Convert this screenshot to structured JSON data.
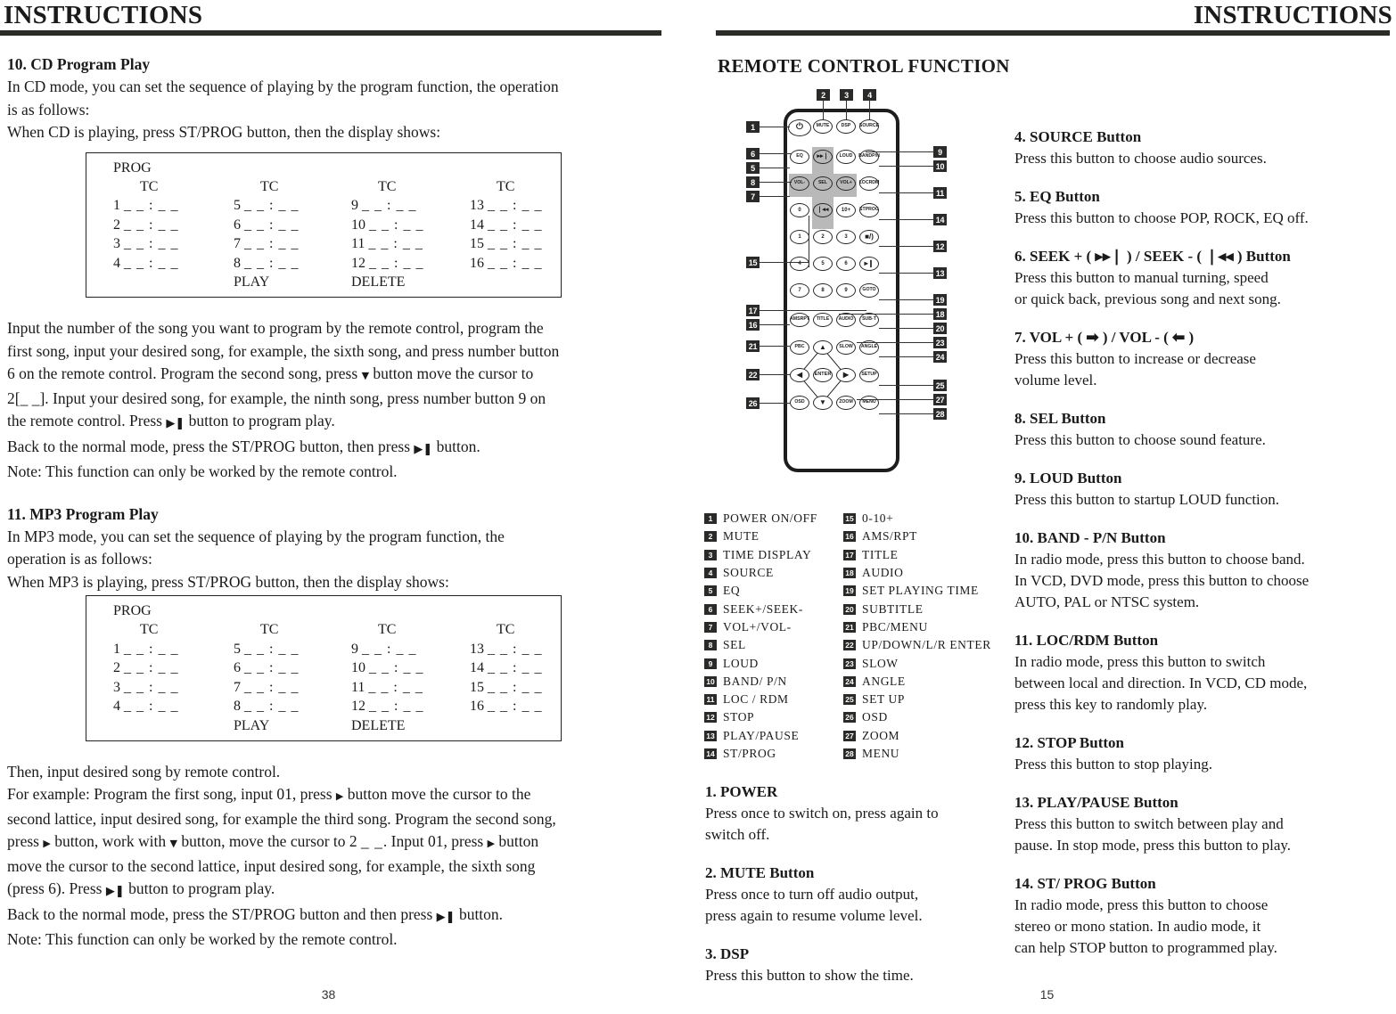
{
  "left_page": {
    "header_title": "INSTRUCTIONS",
    "page_number": "38",
    "section10": {
      "title": "10. CD Program Play",
      "line1": "In CD mode, you can set the sequence of playing by the program function, the operation",
      "line2": "is as follows:",
      "line3": "When CD is playing, press ST/PROG button, then the display shows:"
    },
    "prog_table": {
      "prog_label": "PROG",
      "tc_label": "TC",
      "blank_value": "_ _ : _ _",
      "rows_col1": [
        "1",
        "2",
        "3",
        "4"
      ],
      "rows_col2": [
        "5",
        "6",
        "7",
        "8"
      ],
      "rows_col3": [
        "9",
        "10",
        "11",
        "12"
      ],
      "rows_col4": [
        "13",
        "14",
        "15",
        "16"
      ],
      "play_label": "PLAY",
      "delete_label": "DELETE"
    },
    "para_cd": {
      "l1": "Input the number of the song you want to program by the remote control, program the",
      "l2": "first song, input your desired song, for example, the sixth song, and press number button",
      "l3a": "6 on the remote control. Program the second song, press",
      "l3icon": "▼",
      "l3b": "button move the cursor to",
      "l4a": "2",
      "l4brkt": "[_ _]",
      "l4b": ". Input your desired song, for example, the ninth song, press number button 9 on",
      "l5a": "the remote control. Press",
      "l5icon": "▶❚",
      "l5b": "button to program play.",
      "l6a": "Back to the normal mode, press the ST/PROG button, then press",
      "l6icon": "▶❚",
      "l6b": "button.",
      "l7": "Note: This function can only be worked by the remote control."
    },
    "section11": {
      "title": "11. MP3 Program Play",
      "line1": "In MP3 mode, you can set the sequence of playing by the program function, the",
      "line2": "operation is as follows:",
      "line3": "When MP3 is playing, press ST/PROG button, then the display shows:"
    },
    "para_mp3": {
      "l1": "Then, input desired song by remote control.",
      "l2a": "For example: Program the first song, input 01, press",
      "l2icon": "▶",
      "l2b": "button move the cursor to the",
      "l3": "second lattice, input desired song, for example the third song. Program the second song,",
      "l4a": "press",
      "l4icon1": "▶",
      "l4b": "button, work with",
      "l4icon2": "▼",
      "l4c": "button, move the cursor to 2",
      "l4blank": "_ _",
      "l4d": ". Input 01, press",
      "l4icon3": "▶",
      "l4e": "button",
      "l5": "move the cursor to the second lattice, input desired song, for example, the sixth song",
      "l6a": "(press 6). Press",
      "l6icon": "▶❚",
      "l6b": "button to program play.",
      "l7a": "Back to the normal mode, press the ST/PROG button and then press",
      "l7icon": "▶❚",
      "l7b": "button.",
      "l8": "Note: This function can only be worked by the remote control."
    }
  },
  "right_page": {
    "header_title": "INSTRUCTIONS",
    "page_number": "15",
    "section_heading": "REMOTE CONTROL FUNCTION",
    "remote": {
      "buttons": [
        {
          "label": "⏻",
          "row": 0,
          "col": 0,
          "shaded": false,
          "name": "power"
        },
        {
          "label": "MUTE",
          "row": 0,
          "col": 1,
          "shaded": false,
          "name": "mute"
        },
        {
          "label": "DSP",
          "row": 0,
          "col": 2,
          "shaded": false,
          "name": "dsp"
        },
        {
          "label": "SOURCE",
          "row": 0,
          "col": 3,
          "shaded": false,
          "name": "source"
        },
        {
          "label": "EQ",
          "row": 1,
          "col": 0,
          "shaded": false,
          "name": "eq"
        },
        {
          "label": "▸▸❘",
          "row": 1,
          "col": 1,
          "shaded": true,
          "name": "seek-plus"
        },
        {
          "label": "LOUD",
          "row": 1,
          "col": 2,
          "shaded": false,
          "name": "loud"
        },
        {
          "label": "BAND\nP/N",
          "row": 1,
          "col": 3,
          "shaded": false,
          "name": "band-pn"
        },
        {
          "label": "VOL-",
          "row": 2,
          "col": 0,
          "shaded": true,
          "name": "vol-minus"
        },
        {
          "label": "SEL",
          "row": 2,
          "col": 1,
          "shaded": true,
          "name": "sel"
        },
        {
          "label": "VOL+",
          "row": 2,
          "col": 2,
          "shaded": true,
          "name": "vol-plus"
        },
        {
          "label": "LOC\nRDM",
          "row": 2,
          "col": 3,
          "shaded": false,
          "name": "loc-rdm"
        },
        {
          "label": "0",
          "row": 3,
          "col": 0,
          "shaded": false,
          "name": "num-0"
        },
        {
          "label": "❘◂◂",
          "row": 3,
          "col": 1,
          "shaded": true,
          "name": "seek-minus"
        },
        {
          "label": "10+",
          "row": 3,
          "col": 2,
          "shaded": false,
          "name": "num-10plus"
        },
        {
          "label": "ST\nPROG",
          "row": 3,
          "col": 3,
          "shaded": false,
          "name": "st-prog"
        },
        {
          "label": "1",
          "row": 4,
          "col": 0,
          "shaded": false,
          "name": "num-1"
        },
        {
          "label": "2",
          "row": 4,
          "col": 1,
          "shaded": false,
          "name": "num-2"
        },
        {
          "label": "3",
          "row": 4,
          "col": 2,
          "shaded": false,
          "name": "num-3"
        },
        {
          "label": "■/)",
          "row": 4,
          "col": 3,
          "shaded": false,
          "name": "stop"
        },
        {
          "label": "4",
          "row": 5,
          "col": 0,
          "shaded": false,
          "name": "num-4"
        },
        {
          "label": "5",
          "row": 5,
          "col": 1,
          "shaded": false,
          "name": "num-5"
        },
        {
          "label": "6",
          "row": 5,
          "col": 2,
          "shaded": false,
          "name": "num-6"
        },
        {
          "label": "▸❙",
          "row": 5,
          "col": 3,
          "shaded": false,
          "name": "play-pause"
        },
        {
          "label": "7",
          "row": 6,
          "col": 0,
          "shaded": false,
          "name": "num-7"
        },
        {
          "label": "8",
          "row": 6,
          "col": 1,
          "shaded": false,
          "name": "num-8"
        },
        {
          "label": "9",
          "row": 6,
          "col": 2,
          "shaded": false,
          "name": "num-9"
        },
        {
          "label": "GOTO",
          "row": 6,
          "col": 3,
          "shaded": false,
          "name": "goto"
        },
        {
          "label": "AMS\nRPT",
          "row": 7,
          "col": 0,
          "shaded": false,
          "name": "ams-rpt"
        },
        {
          "label": "TITLE",
          "row": 7,
          "col": 1,
          "shaded": false,
          "name": "title"
        },
        {
          "label": "AUDIO",
          "row": 7,
          "col": 2,
          "shaded": false,
          "name": "audio"
        },
        {
          "label": "SUB-T",
          "row": 7,
          "col": 3,
          "shaded": false,
          "name": "sub-t"
        },
        {
          "label": "PBC",
          "row": 8,
          "col": 0,
          "shaded": false,
          "name": "pbc"
        },
        {
          "label": "▲",
          "row": 8,
          "col": 1,
          "shaded": false,
          "name": "up"
        },
        {
          "label": "SLOW",
          "row": 8,
          "col": 2,
          "shaded": false,
          "name": "slow"
        },
        {
          "label": "ANGLE",
          "row": 8,
          "col": 3,
          "shaded": false,
          "name": "angle"
        },
        {
          "label": "◀",
          "row": 9,
          "col": 0,
          "shaded": false,
          "name": "left"
        },
        {
          "label": "ENTER",
          "row": 9,
          "col": 1,
          "shaded": false,
          "name": "enter"
        },
        {
          "label": "▶",
          "row": 9,
          "col": 2,
          "shaded": false,
          "name": "right"
        },
        {
          "label": "SETUP",
          "row": 9,
          "col": 3,
          "shaded": false,
          "name": "setup"
        },
        {
          "label": "OSD",
          "row": 10,
          "col": 0,
          "shaded": false,
          "name": "osd"
        },
        {
          "label": "▼",
          "row": 10,
          "col": 1,
          "shaded": false,
          "name": "down"
        },
        {
          "label": "ZOOM",
          "row": 10,
          "col": 2,
          "shaded": false,
          "name": "zoom"
        },
        {
          "label": "MENU",
          "row": 10,
          "col": 3,
          "shaded": false,
          "name": "menu"
        }
      ],
      "top_callouts": [
        "2",
        "3",
        "4"
      ],
      "left_callouts": [
        "1",
        "6",
        "5",
        "8",
        "7",
        "15",
        "17",
        "16",
        "21",
        "22",
        "26"
      ],
      "right_callouts": [
        "9",
        "10",
        "11",
        "14",
        "12",
        "13",
        "19",
        "18",
        "20",
        "23",
        "24",
        "25",
        "27",
        "28"
      ]
    },
    "legend_col1": [
      {
        "n": "1",
        "t": "POWER ON/OFF"
      },
      {
        "n": "2",
        "t": "MUTE"
      },
      {
        "n": "3",
        "t": "TIME DISPLAY"
      },
      {
        "n": "4",
        "t": "SOURCE"
      },
      {
        "n": "5",
        "t": "EQ"
      },
      {
        "n": "6",
        "t": "SEEK+/SEEK-"
      },
      {
        "n": "7",
        "t": "VOL+/VOL-"
      },
      {
        "n": "8",
        "t": "SEL"
      },
      {
        "n": "9",
        "t": "LOUD"
      },
      {
        "n": "10",
        "t": "BAND/ P/N"
      },
      {
        "n": "11",
        "t": "LOC / RDM"
      },
      {
        "n": "12",
        "t": "STOP"
      },
      {
        "n": "13",
        "t": "PLAY/PAUSE"
      },
      {
        "n": "14",
        "t": "ST/PROG"
      }
    ],
    "legend_col2": [
      {
        "n": "15",
        "t": "0-10+"
      },
      {
        "n": "16",
        "t": "AMS/RPT"
      },
      {
        "n": "17",
        "t": "TITLE"
      },
      {
        "n": "18",
        "t": "AUDIO"
      },
      {
        "n": "19",
        "t": "SET PLAYING TIME"
      },
      {
        "n": "20",
        "t": "SUBTITLE"
      },
      {
        "n": "21",
        "t": "PBC/MENU"
      },
      {
        "n": "22",
        "t": " UP/DOWN/L/R ENTER"
      },
      {
        "n": "23",
        "t": "SLOW"
      },
      {
        "n": "24",
        "t": "ANGLE"
      },
      {
        "n": "25",
        "t": "SET UP"
      },
      {
        "n": "26",
        "t": "OSD"
      },
      {
        "n": "27",
        "t": "ZOOM"
      },
      {
        "n": "28",
        "t": "MENU"
      }
    ],
    "entries_lower_left": [
      {
        "title": "1. POWER",
        "lines": [
          "Press once to switch on, press again to",
          "switch off."
        ]
      },
      {
        "title": "2. MUTE Button",
        "lines": [
          "Press once to turn off audio output,",
          "press again to resume volume level."
        ]
      },
      {
        "title": "3. DSP",
        "lines": [
          "Press this button to show the time."
        ]
      }
    ],
    "entries_right": [
      {
        "title": "4. SOURCE Button",
        "lines": [
          "Press this button to choose audio sources."
        ]
      },
      {
        "title": "5. EQ Button",
        "lines": [
          "Press this button to choose POP, ROCK, EQ off."
        ]
      },
      {
        "title": "6. SEEK + ( ▸▸❘ ) / SEEK - ( ❘◂◂ ) Button",
        "lines": [
          "Press this button to manual turning, speed",
          "or quick back, previous song and next song."
        ]
      },
      {
        "title": "7. VOL + ( ➡ ) / VOL - ( ⬅ )",
        "lines": [
          "Press this button to increase or decrease",
          "volume level."
        ]
      },
      {
        "title": "8. SEL Button",
        "lines": [
          "Press this button to choose sound feature."
        ]
      },
      {
        "title": "9. LOUD Button",
        "lines": [
          "Press this button to startup LOUD function."
        ]
      },
      {
        "title": "10. BAND - P/N Button",
        "lines": [
          "In radio mode, press this button to choose band.",
          "In VCD, DVD mode, press this button to choose",
          "AUTO, PAL or NTSC system."
        ]
      },
      {
        "title": "11. LOC/RDM Button",
        "lines": [
          "In radio mode, press this button to switch",
          "between local and direction. In VCD, CD mode,",
          "press this key to randomly play."
        ]
      },
      {
        "title": "12. STOP Button",
        "lines": [
          "Press this button to stop playing."
        ]
      },
      {
        "title": "13. PLAY/PAUSE Button",
        "lines": [
          "Press this button to switch between play and",
          "pause. In stop mode, press this button to play."
        ]
      },
      {
        "title": "14. ST/ PROG Button",
        "lines": [
          "In radio mode, press this button to choose",
          "stereo or mono station. In audio mode, it",
          "can help STOP button to programmed play."
        ]
      }
    ]
  }
}
